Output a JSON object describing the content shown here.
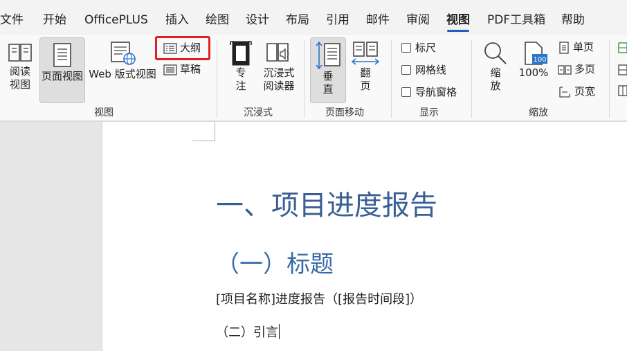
{
  "menu": [
    {
      "label": "文件"
    },
    {
      "label": "开始"
    },
    {
      "label": "OfficePLUS"
    },
    {
      "label": "插入"
    },
    {
      "label": "绘图"
    },
    {
      "label": "设计"
    },
    {
      "label": "布局"
    },
    {
      "label": "引用"
    },
    {
      "label": "邮件"
    },
    {
      "label": "审阅"
    },
    {
      "label": "视图",
      "active": true
    },
    {
      "label": "PDF工具箱"
    },
    {
      "label": "帮助"
    }
  ],
  "ribbon": {
    "views": {
      "label": "视图",
      "read_mode": "阅读\n视图",
      "read_mode_1": "阅读",
      "read_mode_2": "视图",
      "print_layout": "页面视图",
      "web_layout": "Web 版式视图",
      "outline": "大纲",
      "draft": "草稿"
    },
    "immersive": {
      "label": "沉浸式",
      "focus_1": "专",
      "focus_2": "注",
      "reader_1": "沉浸式",
      "reader_2": "阅读器"
    },
    "page_movement": {
      "label": "页面移动",
      "vertical_1": "垂",
      "vertical_2": "直",
      "side_1": "翻",
      "side_2": "页"
    },
    "show": {
      "label": "显示",
      "ruler": "标尺",
      "gridlines": "网格线",
      "nav_pane": "导航窗格"
    },
    "zoom": {
      "label": "缩放",
      "zoom_1": "缩",
      "zoom_2": "放",
      "zoom_100": "100%",
      "icon_100": "100",
      "one_page": "单页",
      "multi_page": "多页",
      "page_width": "页宽"
    }
  },
  "document": {
    "heading1": "一、项目进度报告",
    "heading2": "（一）标题",
    "paragraph": "[项目名称]进度报告（[报告时间段]）",
    "paragraph2": "（二）引言"
  },
  "colors": {
    "accent": "#1f5fbf",
    "heading": "#3a5f94",
    "highlight": "#e02020"
  }
}
